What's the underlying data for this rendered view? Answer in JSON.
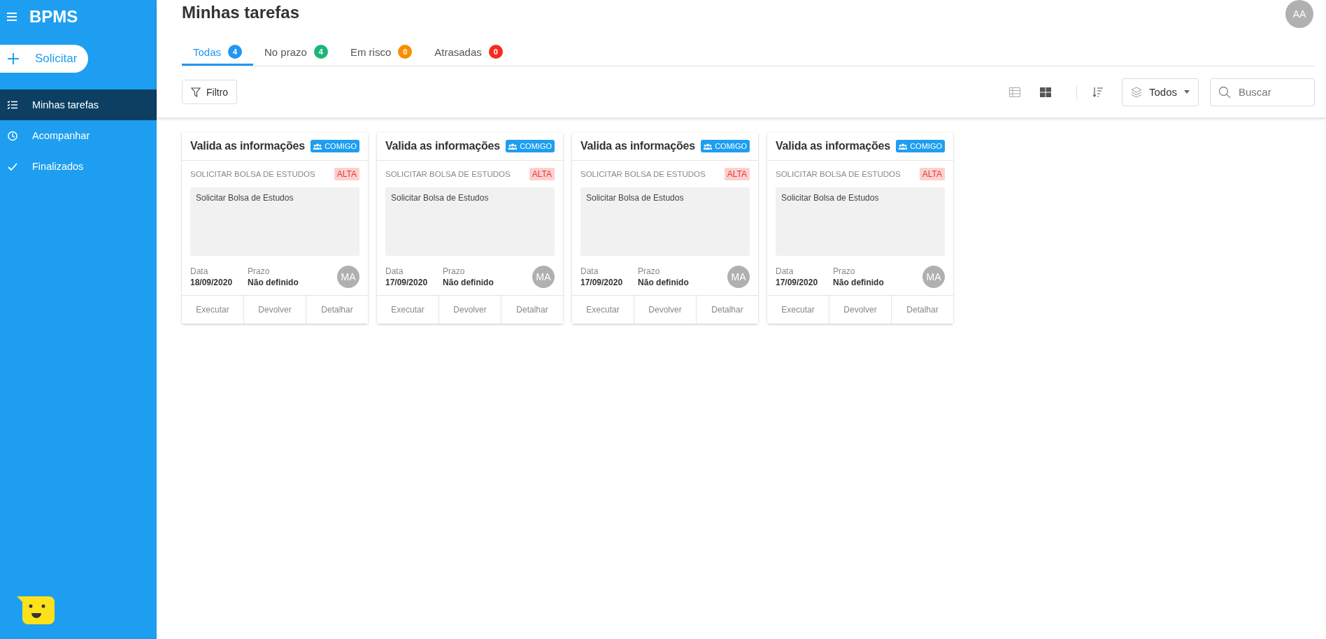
{
  "sidebar": {
    "app_name": "BPMS",
    "new_button": "Solicitar",
    "items": [
      {
        "label": "Minhas tarefas",
        "kind": "checklist",
        "selected": true
      },
      {
        "label": "Acompanhar",
        "kind": "clock",
        "selected": false
      },
      {
        "label": "Finalizados",
        "kind": "check",
        "selected": false
      }
    ]
  },
  "header": {
    "title": "Minhas tarefas",
    "user_avatar": "AA"
  },
  "tabs": [
    {
      "label": "Todas",
      "count": "4",
      "color": "#2196f3",
      "selected": true
    },
    {
      "label": "No prazo",
      "count": "4",
      "color": "#1db67a",
      "selected": false
    },
    {
      "label": "Em risco",
      "count": "0",
      "color": "#fb8c00",
      "selected": false
    },
    {
      "label": "Atrasadas",
      "count": "0",
      "color": "#f42b1e",
      "selected": false
    }
  ],
  "toolbar": {
    "filter_button": "Filtro",
    "views": [
      {
        "kind": "table",
        "selected": false
      },
      {
        "kind": "grid",
        "selected": true
      }
    ],
    "scope_dropdown": "Todos",
    "search": {
      "placeholder": "Buscar"
    }
  },
  "cards": [
    {
      "title": "Valida as informações",
      "tag": "COMIGO",
      "process": "SOLICITAR BOLSA DE ESTUDOS",
      "priority": "ALTA",
      "description": "Solicitar Bolsa de Estudos",
      "date_label": "Data",
      "date": "18/09/2020",
      "deadline_label": "Prazo",
      "deadline": "Não definido",
      "assignee": "MA",
      "actions": [
        "Executar",
        "Devolver",
        "Detalhar"
      ]
    },
    {
      "title": "Valida as informações",
      "tag": "COMIGO",
      "process": "SOLICITAR BOLSA DE ESTUDOS",
      "priority": "ALTA",
      "description": "Solicitar Bolsa de Estudos",
      "date_label": "Data",
      "date": "17/09/2020",
      "deadline_label": "Prazo",
      "deadline": "Não definido",
      "assignee": "MA",
      "actions": [
        "Executar",
        "Devolver",
        "Detalhar"
      ]
    },
    {
      "title": "Valida as informações",
      "tag": "COMIGO",
      "process": "SOLICITAR BOLSA DE ESTUDOS",
      "priority": "ALTA",
      "description": "Solicitar Bolsa de Estudos",
      "date_label": "Data",
      "date": "17/09/2020",
      "deadline_label": "Prazo",
      "deadline": "Não definido",
      "assignee": "MA",
      "actions": [
        "Executar",
        "Devolver",
        "Detalhar"
      ]
    },
    {
      "title": "Valida as informações",
      "tag": "COMIGO",
      "process": "SOLICITAR BOLSA DE ESTUDOS",
      "priority": "ALTA",
      "description": "Solicitar Bolsa de Estudos",
      "date_label": "Data",
      "date": "17/09/2020",
      "deadline_label": "Prazo",
      "deadline": "Não definido",
      "assignee": "MA",
      "actions": [
        "Executar",
        "Devolver",
        "Detalhar"
      ]
    }
  ]
}
